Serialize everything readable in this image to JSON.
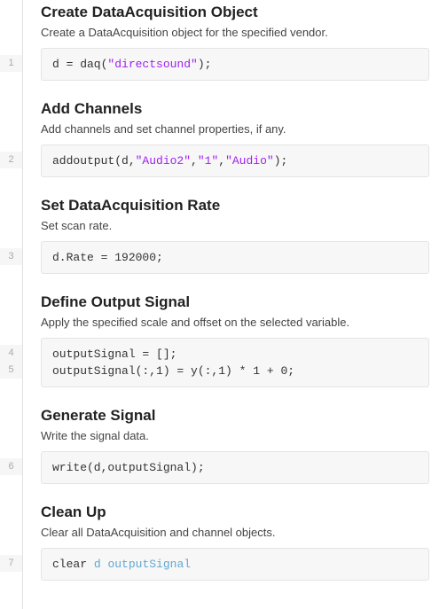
{
  "sections": [
    {
      "heading": "Create DataAcquisition Object",
      "desc": "Create a DataAcquisition object for the specified vendor.",
      "lines": [
        "1"
      ],
      "code_html": "d = daq(<span class='tok-str'>\"directsound\"</span>);"
    },
    {
      "heading": "Add Channels",
      "desc": "Add channels and set channel properties, if any.",
      "lines": [
        "2"
      ],
      "code_html": "addoutput(d,<span class='tok-str'>\"Audio2\"</span>,<span class='tok-str'>\"1\"</span>,<span class='tok-str'>\"Audio\"</span>);"
    },
    {
      "heading": "Set DataAcquisition Rate",
      "desc": "Set scan rate.",
      "lines": [
        "3"
      ],
      "code_html": "d.Rate = 192000;"
    },
    {
      "heading": "Define Output Signal",
      "desc": "Apply the specified scale and offset on the selected variable.",
      "lines": [
        "4",
        "5"
      ],
      "code_html": "outputSignal = [];\noutputSignal(:,1) = y(:,1) * 1 + 0;"
    },
    {
      "heading": "Generate Signal",
      "desc": "Write the signal data.",
      "lines": [
        "6"
      ],
      "code_html": "write(d,outputSignal);"
    },
    {
      "heading": "Clean Up",
      "desc": "Clear all DataAcquisition and channel objects.",
      "lines": [
        "7"
      ],
      "code_html": "clear <span class='tok-var'>d</span> <span class='tok-var'>outputSignal</span>"
    }
  ]
}
